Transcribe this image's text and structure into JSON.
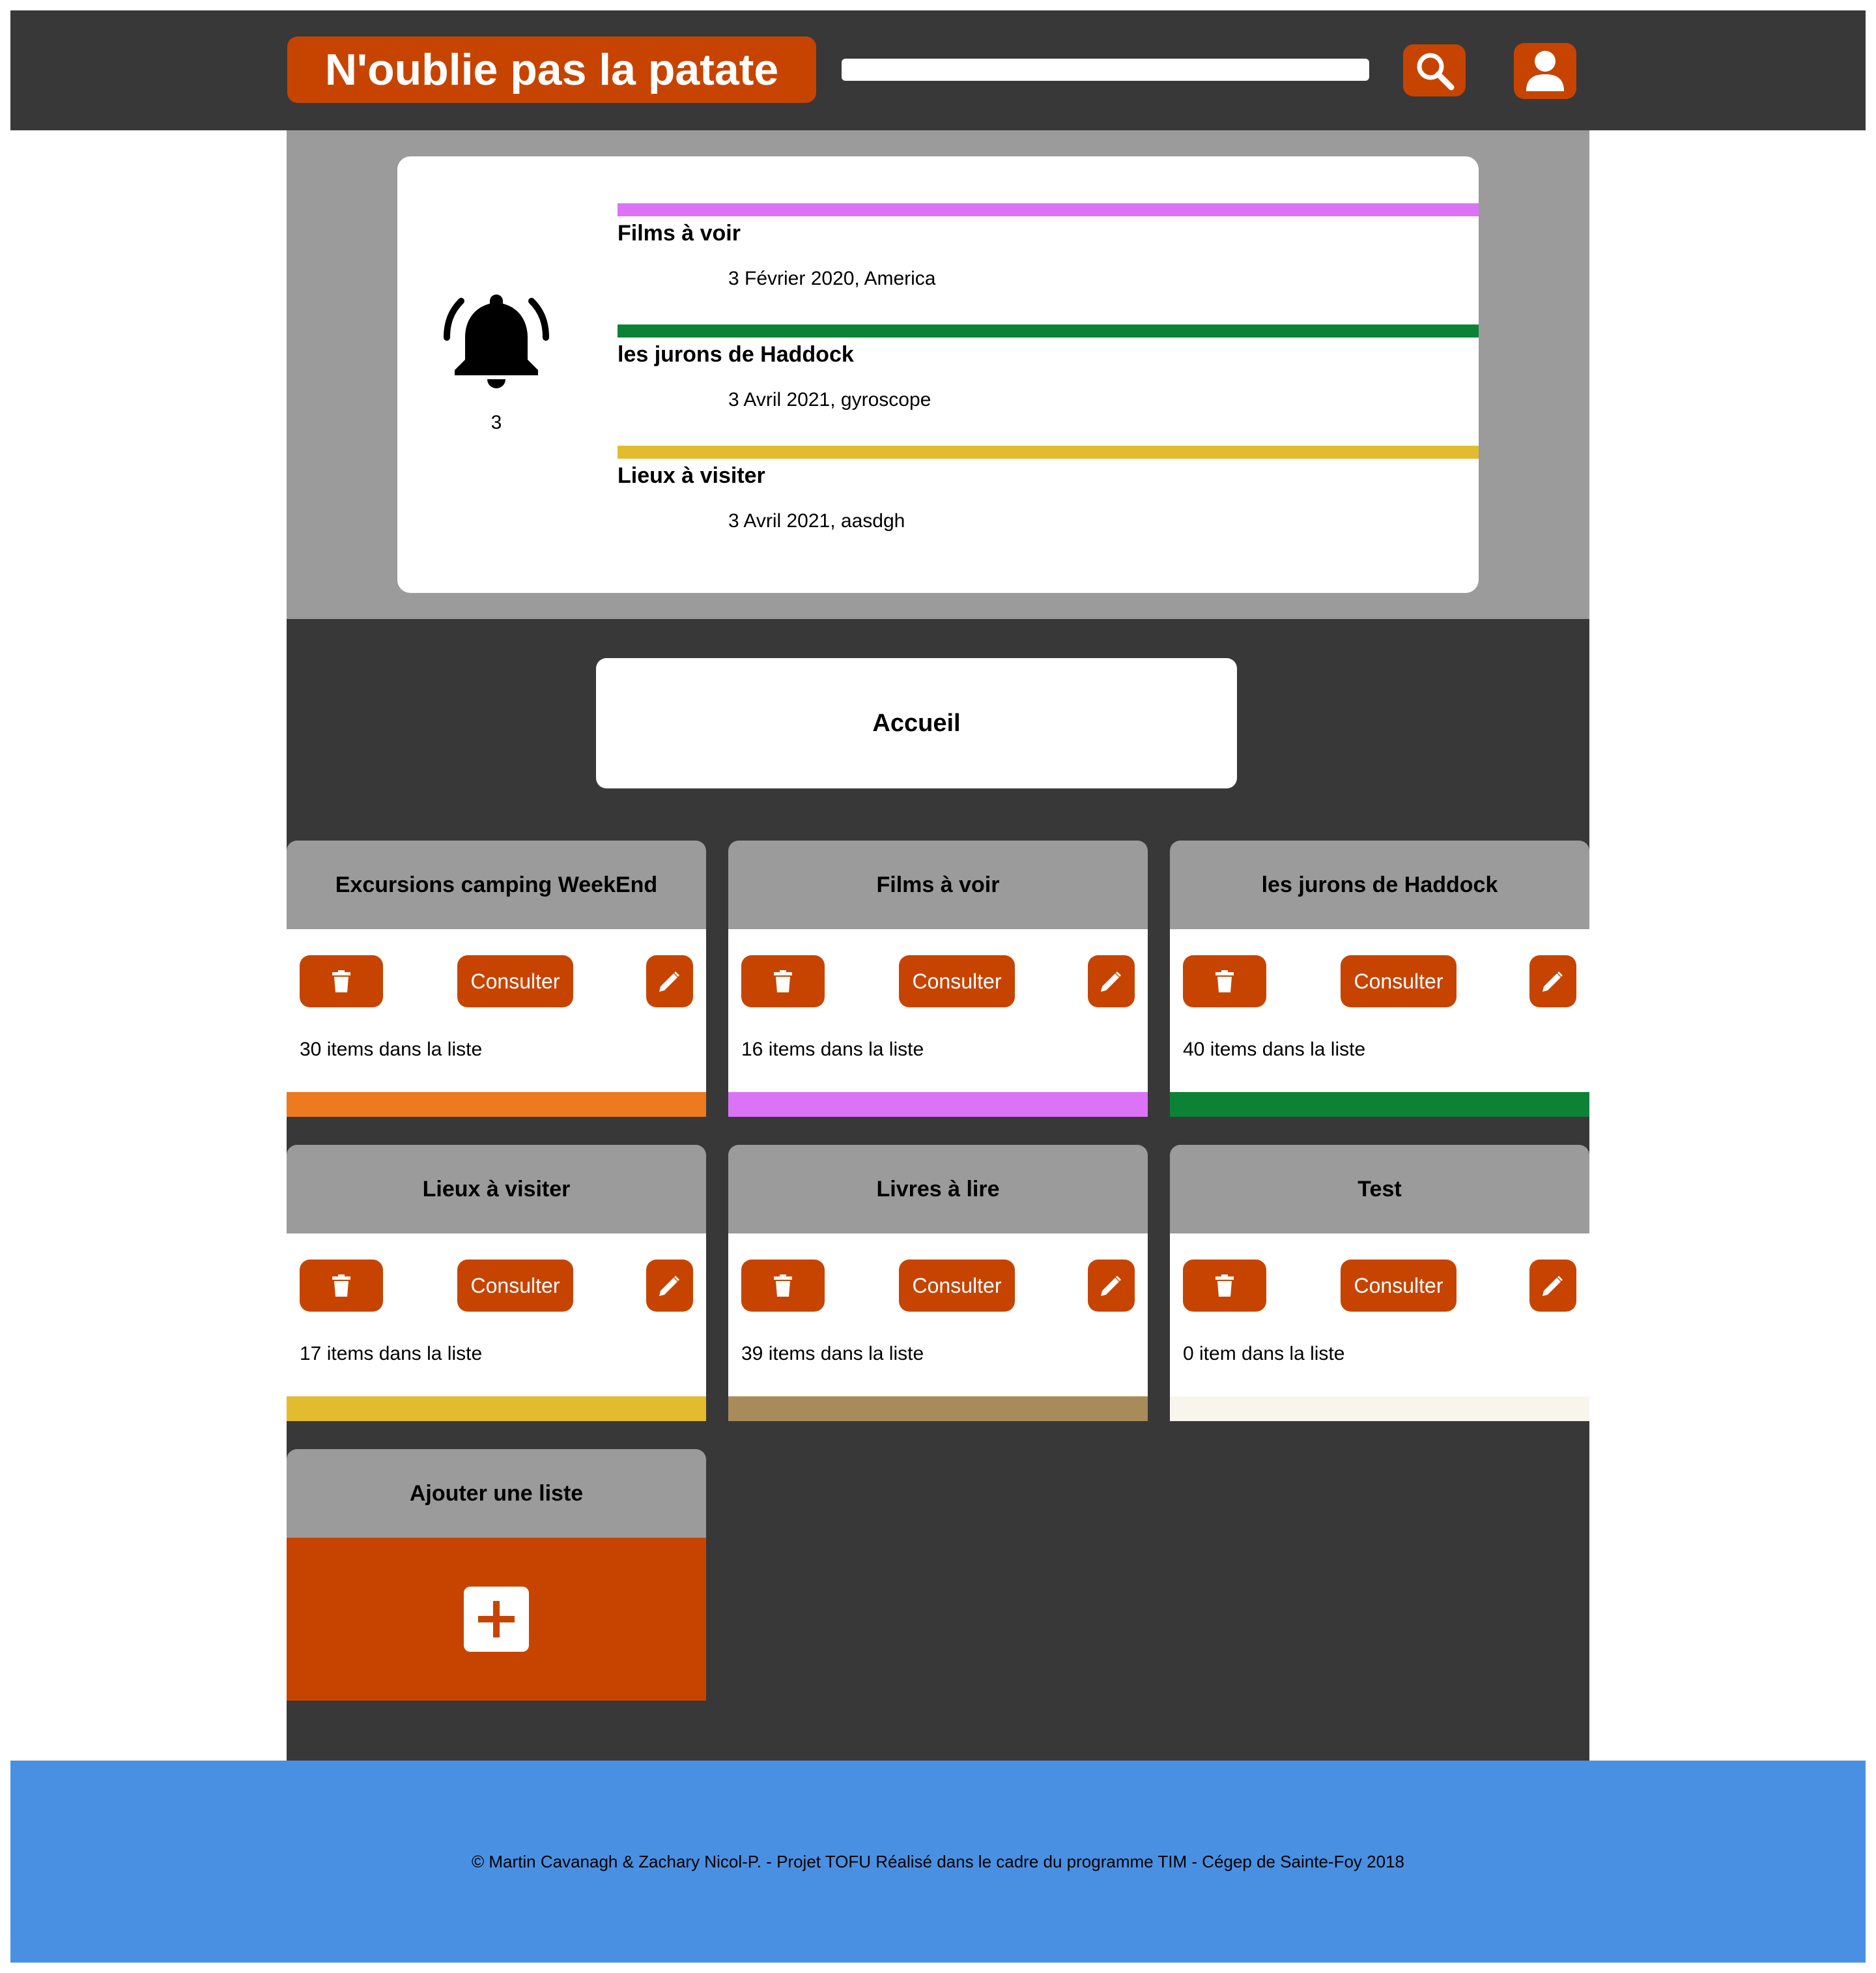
{
  "header": {
    "logo": "N'oublie pas la patate",
    "search_value": "",
    "search_icon": "search-icon",
    "user_icon": "user-icon"
  },
  "colors": {
    "accent": "#c74400",
    "header_bg": "#383838",
    "band_bg": "#9b9b9b",
    "footer_bg": "#4a90e2"
  },
  "notifications": {
    "count": "3",
    "icon": "bell-icon",
    "items": [
      {
        "title": "Films à voir",
        "subtitle": "3 Février 2020, America",
        "color": "#dc73f6"
      },
      {
        "title": "les jurons de Haddock",
        "subtitle": "3 Avril 2021, gyroscope",
        "color": "#0b8236"
      },
      {
        "title": "Lieux à visiter",
        "subtitle": "3 Avril 2021, aasdgh",
        "color": "#e2bb2f"
      }
    ]
  },
  "main": {
    "page_title": "Accueil",
    "consult_label": "Consulter",
    "lists": [
      {
        "title": "Excursions camping WeekEnd",
        "count_text": "30 items dans la liste",
        "color": "#ed7a1f"
      },
      {
        "title": "Films à voir",
        "count_text": "16 items dans la liste",
        "color": "#dc73f6"
      },
      {
        "title": "les jurons de Haddock",
        "count_text": "40 items dans la liste",
        "color": "#0b8236"
      },
      {
        "title": "Lieux à visiter",
        "count_text": "17 items dans la liste",
        "color": "#e2bb2f"
      },
      {
        "title": "Livres à lire",
        "count_text": "39 items dans la liste",
        "color": "#a88b5a"
      },
      {
        "title": "Test",
        "count_text": "0 item dans la liste",
        "color": "#f8f6ec"
      }
    ],
    "add_list": {
      "title": "Ajouter une liste",
      "icon": "plus-icon"
    }
  },
  "footer": {
    "text": "© Martin Cavanagh & Zachary Nicol-P. - Projet TOFU Réalisé dans le cadre du programme TIM - Cégep de Sainte-Foy 2018"
  }
}
